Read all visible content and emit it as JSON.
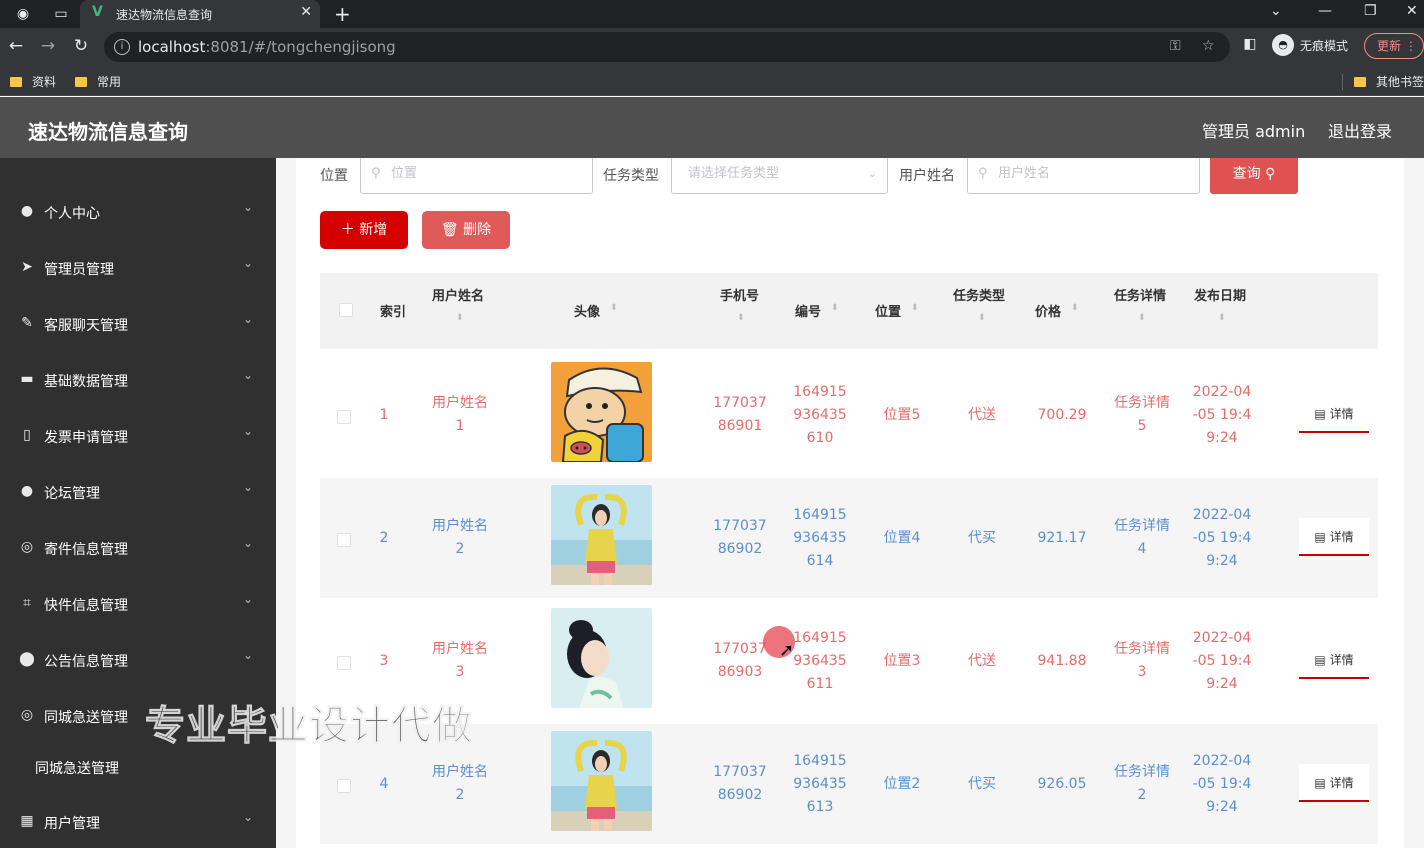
{
  "browser": {
    "tab_title": "速达物流信息查询",
    "url_host": "localhost",
    "url_rest": ":8081/#/tongchengjisong",
    "incognito_label": "无痕模式",
    "update_label": "更新",
    "bookmarks": [
      "资料",
      "常用",
      "其他书签"
    ]
  },
  "header": {
    "app_title": "速达物流信息查询",
    "user_label": "管理员 admin",
    "logout_label": "退出登录"
  },
  "sidebar": {
    "items": [
      {
        "label": "个人中心",
        "icon": "user-icon"
      },
      {
        "label": "管理员管理",
        "icon": "send-icon"
      },
      {
        "label": "客服聊天管理",
        "icon": "edit-icon"
      },
      {
        "label": "基础数据管理",
        "icon": "monitor-icon"
      },
      {
        "label": "发票申请管理",
        "icon": "phone-icon"
      },
      {
        "label": "论坛管理",
        "icon": "user-icon"
      },
      {
        "label": "寄件信息管理",
        "icon": "globe-icon"
      },
      {
        "label": "快件信息管理",
        "icon": "crop-icon"
      },
      {
        "label": "公告信息管理",
        "icon": "location-icon"
      },
      {
        "label": "同城急送管理",
        "icon": "globe-icon"
      }
    ],
    "submenu_label": "同城急送管理",
    "last_item": {
      "label": "用户管理",
      "icon": "grid-icon"
    }
  },
  "filters": {
    "location_label": "位置",
    "location_placeholder": "位置",
    "task_type_label": "任务类型",
    "task_type_placeholder": "请选择任务类型",
    "username_label": "用户姓名",
    "username_placeholder": "用户姓名",
    "query_button": "查询"
  },
  "actions": {
    "add_button": "新增",
    "delete_button": "删除"
  },
  "table": {
    "headers": {
      "index": "索引",
      "username": "用户姓名",
      "avatar": "头像",
      "phone": "手机号",
      "number": "编号",
      "location": "位置",
      "task_type": "任务类型",
      "price": "价格",
      "task_detail": "任务详情",
      "publish_date": "发布日期"
    },
    "detail_button": "详情",
    "rows": [
      {
        "index": "1",
        "username": "用户姓名1",
        "phone": "17703786901",
        "number": "164915936435610",
        "location": "位置5",
        "task_type": "代送",
        "price": "700.29",
        "task_detail": "任务详情5",
        "date": "2022-04-05 19:49:24",
        "color": "red"
      },
      {
        "index": "2",
        "username": "用户姓名2",
        "phone": "17703786902",
        "number": "164915936435614",
        "location": "位置4",
        "task_type": "代买",
        "price": "921.17",
        "task_detail": "任务详情4",
        "date": "2022-04-05 19:49:24",
        "color": "blue"
      },
      {
        "index": "3",
        "username": "用户姓名3",
        "phone": "17703786903",
        "number": "164915936435611",
        "location": "位置3",
        "task_type": "代送",
        "price": "941.88",
        "task_detail": "任务详情3",
        "date": "2022-04-05 19:49:24",
        "color": "red"
      },
      {
        "index": "4",
        "username": "用户姓名2",
        "phone": "17703786902",
        "number": "164915936435613",
        "location": "位置2",
        "task_type": "代买",
        "price": "926.05",
        "task_detail": "任务详情2",
        "date": "2022-04-05 19:49:24",
        "color": "blue"
      }
    ]
  },
  "watermark": "专业毕业设计代做",
  "colors": {
    "primary": "#d40000",
    "link_red": "#e86b6b",
    "link_blue": "#5b8fce",
    "sidebar_bg": "#303030",
    "header_bg": "#4f4f4f"
  }
}
